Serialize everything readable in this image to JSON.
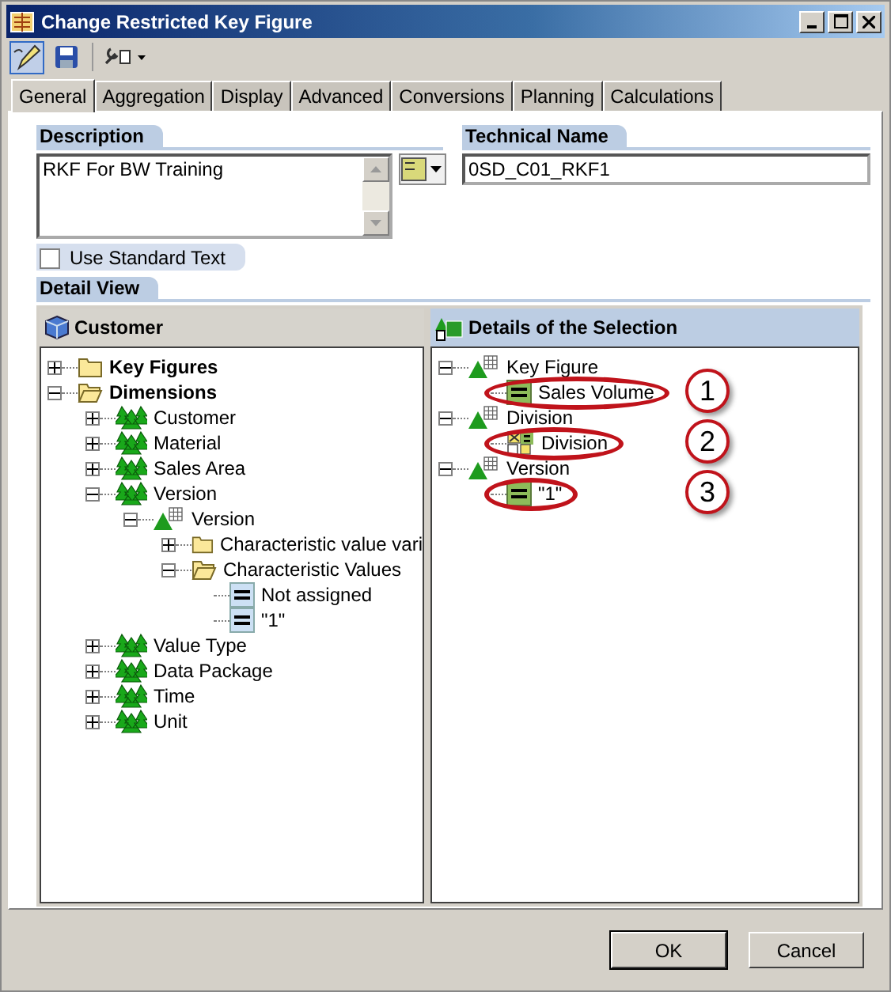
{
  "window": {
    "title": "Change Restricted Key Figure"
  },
  "tabs": [
    {
      "label": "General",
      "selected": true
    },
    {
      "label": "Aggregation",
      "selected": false
    },
    {
      "label": "Display",
      "selected": false
    },
    {
      "label": "Advanced",
      "selected": false
    },
    {
      "label": "Conversions",
      "selected": false
    },
    {
      "label": "Planning",
      "selected": false
    },
    {
      "label": "Calculations",
      "selected": false
    }
  ],
  "description": {
    "label": "Description",
    "value": "RKF For BW Training"
  },
  "technical_name": {
    "label": "Technical Name",
    "value": "0SD_C01_RKF1"
  },
  "use_standard_text": {
    "label": "Use Standard Text",
    "checked": false
  },
  "detail_view": {
    "label": "Detail View",
    "left_tree": {
      "title": "Customer",
      "items": [
        {
          "label": "Key Figures",
          "kind": "folder",
          "bold": true,
          "expanded": false
        },
        {
          "label": "Dimensions",
          "kind": "folder",
          "bold": true,
          "expanded": true,
          "children": [
            {
              "label": "Customer",
              "kind": "characteristic",
              "expanded": false
            },
            {
              "label": "Material",
              "kind": "characteristic",
              "expanded": false
            },
            {
              "label": "Sales Area",
              "kind": "characteristic",
              "expanded": false
            },
            {
              "label": "Version",
              "kind": "characteristic",
              "expanded": true,
              "children": [
                {
                  "label": "Version",
                  "kind": "char-grid",
                  "expanded": true,
                  "children": [
                    {
                      "label": "Characteristic value vari",
                      "kind": "folder",
                      "expanded": false
                    },
                    {
                      "label": "Characteristic Values",
                      "kind": "folder",
                      "expanded": true,
                      "children": [
                        {
                          "label": "Not assigned",
                          "kind": "value"
                        },
                        {
                          "label": "\"1\"",
                          "kind": "value"
                        }
                      ]
                    }
                  ]
                }
              ]
            },
            {
              "label": "Value Type",
              "kind": "characteristic",
              "expanded": false
            },
            {
              "label": "Data Package",
              "kind": "characteristic",
              "expanded": false
            },
            {
              "label": "Time",
              "kind": "characteristic",
              "expanded": false
            },
            {
              "label": "Unit",
              "kind": "characteristic",
              "expanded": false
            }
          ]
        }
      ]
    },
    "right_tree": {
      "title": "Details of the Selection",
      "items": [
        {
          "label": "Key Figure",
          "kind": "char-grid",
          "expanded": true,
          "children": [
            {
              "label": "Sales Volume",
              "kind": "keyfigure",
              "callout": "1"
            }
          ]
        },
        {
          "label": "Division",
          "kind": "char-grid",
          "expanded": true,
          "children": [
            {
              "label": "Division",
              "kind": "variable",
              "callout": "2"
            }
          ]
        },
        {
          "label": "Version",
          "kind": "char-grid",
          "expanded": true,
          "children": [
            {
              "label": "\"1\"",
              "kind": "keyfigure",
              "callout": "3"
            }
          ]
        }
      ]
    }
  },
  "buttons": [
    "OK",
    "Cancel"
  ]
}
